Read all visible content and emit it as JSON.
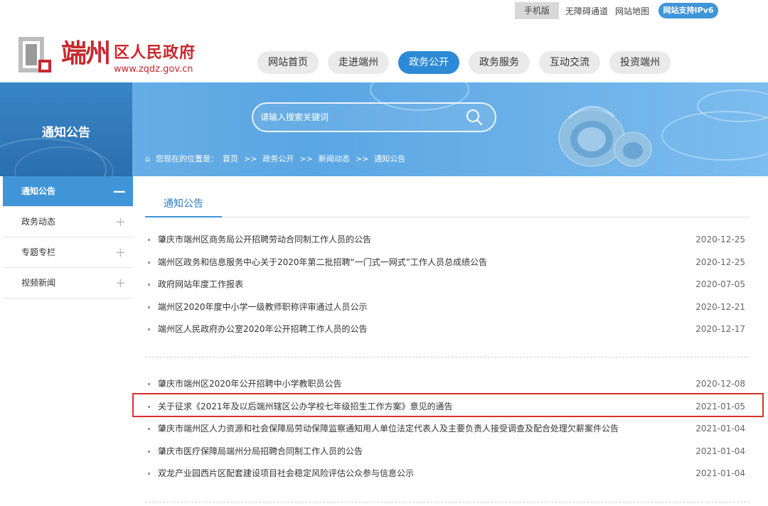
{
  "topbar": {
    "mobile": "手机版",
    "accessibility": "无障碍通道",
    "sitemap": "网站地图",
    "ipv6": "网站支持IPv6"
  },
  "logo": {
    "calligraphy": "端州",
    "name": "区人民政府",
    "url": "www.zqdz.gov.cn"
  },
  "nav": [
    {
      "label": "网站首页"
    },
    {
      "label": "走进端州"
    },
    {
      "label": "政务公开"
    },
    {
      "label": "政务服务"
    },
    {
      "label": "互动交流"
    },
    {
      "label": "投资端州"
    }
  ],
  "nav_active_index": 2,
  "banner": {
    "section_title": "通知公告",
    "search_placeholder": "请输入搜索关键词",
    "breadcrumb": {
      "prefix": "您现在的位置是：",
      "items": [
        "首页",
        ">>",
        "政务公开",
        ">>",
        "新闻动态",
        ">>",
        "通知公告"
      ]
    }
  },
  "sidebar": {
    "items": [
      {
        "label": "通知公告",
        "sign": "—"
      },
      {
        "label": "政务动态",
        "sign": "+"
      },
      {
        "label": "专题专栏",
        "sign": "+"
      },
      {
        "label": "视频新闻",
        "sign": "+"
      }
    ]
  },
  "content": {
    "title": "通知公告",
    "group1": [
      {
        "title": "肇庆市端州区商务局公开招聘劳动合同制工作人员的公告",
        "date": "2020-12-25"
      },
      {
        "title": "端州区政务和信息服务中心关于2020年第二批招聘“一门式一网式”工作人员总成绩公告",
        "date": "2020-12-25"
      },
      {
        "title": "政府网站年度工作报表",
        "date": "2020-07-05"
      },
      {
        "title": "端州区2020年度中小学一级教师职称评审通过人员公示",
        "date": "2020-12-21"
      },
      {
        "title": "端州区人民政府办公室2020年公开招聘工作人员的公告",
        "date": "2020-12-17"
      }
    ],
    "group2": [
      {
        "title": "肇庆市端州区2020年公开招聘中小学教职员公告",
        "date": "2020-12-08"
      },
      {
        "title": "关于征求《2021年及以后端州辖区公办学校七年级招生工作方案》意见的通告",
        "date": "2021-01-05"
      },
      {
        "title": "肇庆市端州区人力资源和社会保障局劳动保障监察通知用人单位法定代表人及主要负责人接受调查及配合处理欠薪案件公告",
        "date": "2021-01-04"
      },
      {
        "title": "肇庆市医疗保障局端州分局招聘合同制工作人员的公告",
        "date": "2021-01-04"
      },
      {
        "title": "双龙产业园西片区配套建设项目社会稳定风险评估公众参与信息公示",
        "date": "2021-01-04"
      }
    ]
  },
  "colors": {
    "accent": "#3f95d8",
    "brand_red": "#c8282e",
    "highlight_border": "#d9322b"
  }
}
